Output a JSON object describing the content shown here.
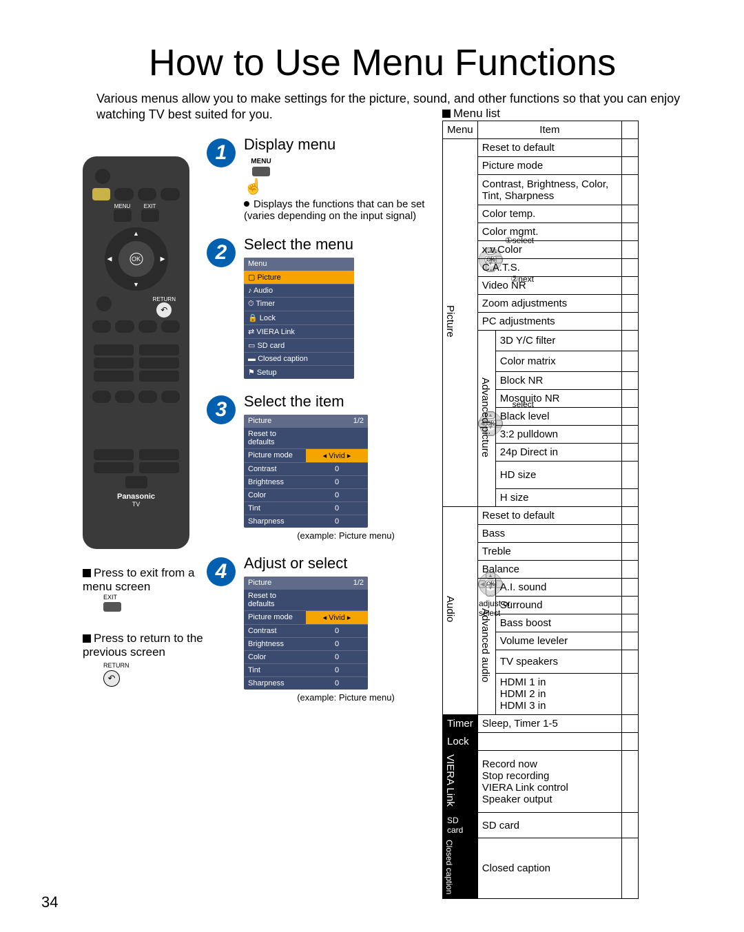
{
  "page_number": "34",
  "title": "How to Use Menu Functions",
  "intro": "Various menus allow you to make settings for the picture, sound, and other functions so that you can enjoy watching TV best suited for you.",
  "remote": {
    "menu_label": "MENU",
    "exit_label": "EXIT",
    "ok_label": "OK",
    "return_label": "RETURN",
    "brand": "Panasonic",
    "type": "TV"
  },
  "exit_block": {
    "text": "Press to exit from a menu screen",
    "label": "EXIT"
  },
  "return_block": {
    "text": "Press to return to the previous screen",
    "label": "RETURN"
  },
  "steps": {
    "1": {
      "title": "Display menu",
      "menu_label": "MENU",
      "note": "Displays the functions that can be set (varies depending on the input signal)"
    },
    "2": {
      "title": "Select the menu",
      "menu_head": "Menu",
      "items": [
        "Picture",
        "Audio",
        "Timer",
        "Lock",
        "VIERA Link",
        "SD card",
        "Closed caption",
        "Setup"
      ],
      "hint_select": "①select",
      "hint_next": "②next"
    },
    "3": {
      "title": "Select the item",
      "hint": "select",
      "menu_head": "Picture",
      "page": "1/2",
      "rows": [
        {
          "label": "Reset to defaults",
          "value": ""
        },
        {
          "label": "Picture mode",
          "value": "Vivid",
          "sel": true
        },
        {
          "label": "Contrast",
          "value": "0"
        },
        {
          "label": "Brightness",
          "value": "0"
        },
        {
          "label": "Color",
          "value": "0"
        },
        {
          "label": "Tint",
          "value": "0"
        },
        {
          "label": "Sharpness",
          "value": "0"
        }
      ],
      "example": "(example: Picture menu)"
    },
    "4": {
      "title": "Adjust or select",
      "hint": "adjust or select",
      "menu_head": "Picture",
      "page": "1/2",
      "rows": [
        {
          "label": "Reset to defaults",
          "value": ""
        },
        {
          "label": "Picture mode",
          "value": "Vivid",
          "sel": true
        },
        {
          "label": "Contrast",
          "value": "0"
        },
        {
          "label": "Brightness",
          "value": "0"
        },
        {
          "label": "Color",
          "value": "0"
        },
        {
          "label": "Tint",
          "value": "0"
        },
        {
          "label": "Sharpness",
          "value": "0"
        }
      ],
      "example": "(example: Picture menu)"
    }
  },
  "menu_list": {
    "title": "Menu list",
    "headers": {
      "menu": "Menu",
      "item": "Item"
    },
    "picture": {
      "label": "Picture",
      "items_top": [
        "Reset to default",
        "Picture mode",
        "Contrast, Brightness, Color, Tint, Sharpness",
        "Color temp.",
        "Color mgmt.",
        "x.v.Color",
        "C.A.T.S.",
        "Video NR",
        "Zoom adjustments",
        "PC adjustments"
      ],
      "adv_label": "Advanced picture",
      "adv_items": [
        "3D Y/C filter",
        "Color matrix",
        "Block NR",
        "Mosquito NR",
        "Black level",
        "3:2 pulldown",
        "24p Direct in",
        "HD size",
        "H size"
      ]
    },
    "audio": {
      "label": "Audio",
      "items_top": [
        "Reset to default",
        "Bass",
        "Treble",
        "Balance"
      ],
      "adv_label": "Advanced audio",
      "adv_items": [
        "A.I. sound",
        "Surround",
        "Bass boost",
        "Volume leveler",
        "TV speakers",
        "HDMI 1 in\nHDMI 2 in\nHDMI 3 in"
      ]
    },
    "timer": {
      "label": "Timer",
      "item": "Sleep, Timer 1-5"
    },
    "lock": {
      "label": "Lock",
      "item": ""
    },
    "viera": {
      "label": "VIERA Link",
      "item": "Record now\nStop recording\nVIERA Link control\nSpeaker output"
    },
    "sdcard": {
      "label": "SD card",
      "item": "SD card"
    },
    "cc": {
      "label": "Closed caption",
      "item": "Closed caption"
    }
  }
}
